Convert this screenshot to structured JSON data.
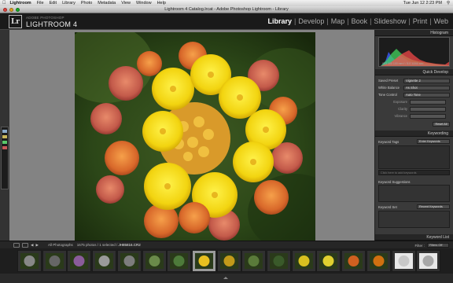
{
  "menubar": {
    "app": "Lightroom",
    "items": [
      "File",
      "Edit",
      "Library",
      "Photo",
      "Metadata",
      "View",
      "Window",
      "Help"
    ],
    "clock": "Tue Jun 12  2:23 PM"
  },
  "window": {
    "title": "Lightroom 4 Catalog.lrcat - Adobe Photoshop Lightroom - Library"
  },
  "identity": {
    "logo": "Lr",
    "subtitle": "ADOBE PHOTOSHOP",
    "product": "LIGHTROOM 4"
  },
  "modules": [
    "Library",
    "Develop",
    "Map",
    "Book",
    "Slideshow",
    "Print",
    "Web"
  ],
  "active_module": "Library",
  "right_panel": {
    "histogram": {
      "title": "Histogram",
      "info": "ISO 100   100 mm   f / 8.0   1/200 sec",
      "colors": {
        "blue": "#3b5cff",
        "green": "#42d45c",
        "red": "#ff4a4a"
      }
    },
    "quick_develop": {
      "title": "Quick Develop",
      "saved_preset_label": "Saved Preset",
      "saved_preset_value": "Vignette 2",
      "white_balance_label": "White Balance",
      "white_balance_value": "As Shot",
      "tone_control_label": "Tone Control",
      "auto_tone_label": "Auto Tone",
      "sub_rows": [
        "Exposure",
        "Clarity",
        "Vibrance"
      ],
      "reset_label": "Reset All"
    },
    "keywording": {
      "title": "Keywording",
      "tags_label": "Keyword Tags",
      "tags_value": "Enter Keywords",
      "input_placeholder": "Click here to add keywords",
      "suggestions_label": "Keyword Suggestions",
      "set_label": "Keyword Set",
      "set_value": "Recent Keywords"
    },
    "keyword_list": {
      "title": "Keyword List"
    }
  },
  "filmstrip": {
    "source": "All Photographs",
    "count": "1675 photos / 1 selected /",
    "filename": "JH85816.CR2",
    "filter_label": "Filter :",
    "filter_value": "Filters Off",
    "thumbnail_colors": [
      "#888",
      "#666",
      "#8a5c9a",
      "#9a9a9a",
      "#7d7d7d",
      "#6a8a4a",
      "#4d7a3a",
      "#e8c020",
      "#c29a1a",
      "#5a7a3a",
      "#3a5a2a",
      "#d8c020",
      "#e0d030",
      "#d06020",
      "#d07010",
      "#c8c8c8",
      "#a8a8a8"
    ]
  }
}
